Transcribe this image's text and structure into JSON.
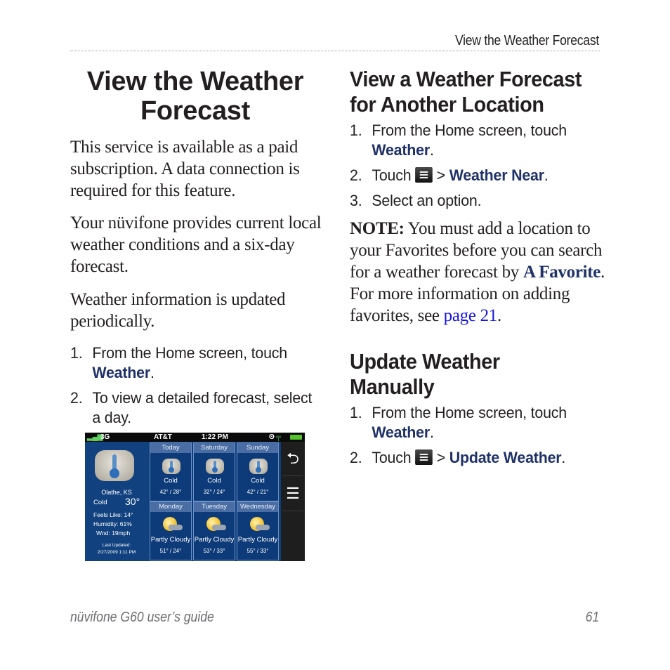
{
  "header": {
    "running_title": "View the Weather Forecast"
  },
  "footer": {
    "guide_title": "nüvifone G60 user’s guide",
    "page_number": "61"
  },
  "left_column": {
    "title": "View the Weather Forecast",
    "paragraphs": [
      "This service is available as a paid subscription. A data connection is required for this feature.",
      "Your nüvifone provides current local weather conditions and a six-day forecast.",
      "Weather information is updated periodically."
    ],
    "steps": [
      {
        "num": "1.",
        "text": "From the Home screen, touch",
        "keyword": "Weather",
        "end": "."
      },
      {
        "num": "2.",
        "text": "To view a detailed forecast, select",
        "cont": "a day."
      }
    ]
  },
  "device_screen": {
    "status": {
      "signal": "3G",
      "carrier": "AT&T",
      "time": "1:22 PM"
    },
    "current": {
      "location": "Olathe, KS",
      "condition": "Cold",
      "temperature": "30°",
      "feels_like": "Feels Like:  14°",
      "humidity": "Humidity:  61%",
      "wind": "Wnd:  19mph",
      "last_updated_label": "Last Updated:",
      "last_updated": "2/27/2009 1:11 PM"
    },
    "forecast": [
      {
        "day": "Today",
        "icon": "thermometer-icon",
        "condition": "Cold",
        "temps": "42° /  28°"
      },
      {
        "day": "Saturday",
        "icon": "thermometer-icon",
        "condition": "Cold",
        "temps": "32° /  24°"
      },
      {
        "day": "Sunday",
        "icon": "thermometer-icon",
        "condition": "Cold",
        "temps": "42° /  21°"
      },
      {
        "day": "Monday",
        "icon": "partly-cloudy-icon",
        "condition": "Partly Cloudy",
        "temps": "51° /  24°"
      },
      {
        "day": "Tuesday",
        "icon": "partly-cloudy-icon",
        "condition": "Partly Cloudy",
        "temps": "53° /  33°"
      },
      {
        "day": "Wednesday",
        "icon": "partly-cloudy-icon",
        "condition": "Partly Cloudy",
        "temps": "55° /  33°"
      }
    ],
    "side_buttons": {
      "back": "⮌",
      "menu": "☰"
    }
  },
  "right_column": {
    "section1": {
      "title_line1": "View a Weather Forecast",
      "title_line2": "for Another Location",
      "steps": [
        {
          "num": "1.",
          "text": "From the Home screen, touch",
          "keyword": "Weather",
          "end": "."
        },
        {
          "num": "2.",
          "prefix": "Touch",
          "sep": ">",
          "keyword": "Weather Near",
          "end": "."
        },
        {
          "num": "3.",
          "text": "Select an option."
        }
      ],
      "note": {
        "label": "NOTE:",
        "line1": " You must add a location to",
        "line2": "your Favorites before you can search",
        "line3": "for a weather forecast by ",
        "keyword": "A Favorite",
        "line3_end": ".",
        "line4": "For more information on adding",
        "line5": "favorites, see ",
        "link": "page 21",
        "line5_end": "."
      }
    },
    "section2": {
      "title_line1": "Update Weather",
      "title_line2": "Manually",
      "steps": [
        {
          "num": "1.",
          "text": "From the Home screen, touch",
          "keyword": "Weather",
          "end": "."
        },
        {
          "num": "2.",
          "prefix": "Touch",
          "sep": ">",
          "keyword": "Update Weather",
          "end": "."
        }
      ]
    }
  }
}
